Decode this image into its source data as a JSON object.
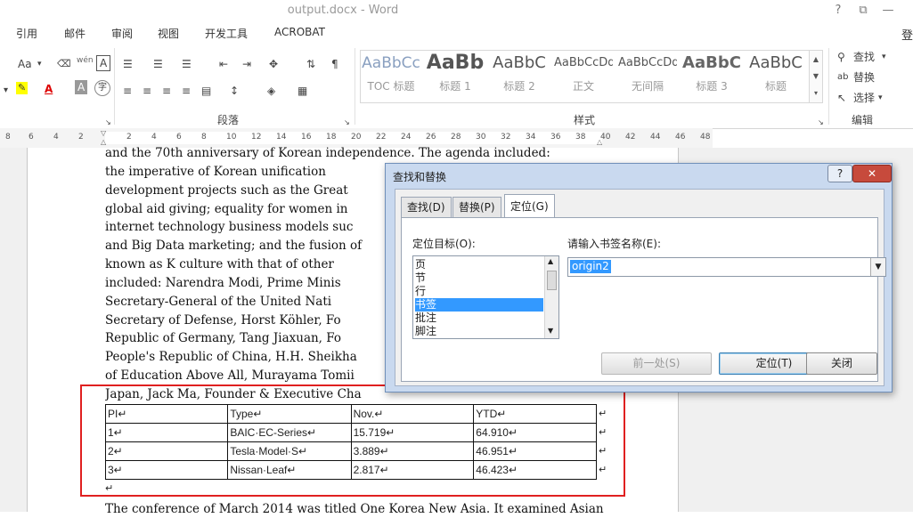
{
  "window": {
    "title": "output.docx - Word",
    "help": "?",
    "restore": "⧉",
    "minimize": "—",
    "user_initial": "登"
  },
  "tabs": [
    "引用",
    "邮件",
    "审阅",
    "视图",
    "开发工具",
    "ACROBAT"
  ],
  "ribbon": {
    "font_size_label": "Aa",
    "pinyin_label": "wén",
    "border_char_label": "A",
    "highlight_label": "A",
    "shading_label": "A",
    "enclose_label": "字",
    "paragraph_group": "段落",
    "styles_group": "样式",
    "edit_group": "编辑",
    "styles": [
      {
        "sample": "AaBbCc",
        "name": "TOC 标题"
      },
      {
        "sample": "AaBb",
        "name": "标题 1"
      },
      {
        "sample": "AaBbC",
        "name": "标题 2"
      },
      {
        "sample": "AaBbCcDd",
        "name": "正文"
      },
      {
        "sample": "AaBbCcDd",
        "name": "无间隔"
      },
      {
        "sample": "AaBbC",
        "name": "标题 3"
      },
      {
        "sample": "AaBbC",
        "name": "标题"
      }
    ],
    "find": "查找",
    "replace": "替换",
    "select": "选择"
  },
  "ruler": {
    "left_ticks": [
      "8",
      "6",
      "4",
      "2"
    ],
    "ticks": [
      "2",
      "4",
      "6",
      "8",
      "10",
      "12",
      "14",
      "16",
      "18",
      "20",
      "22",
      "24",
      "26",
      "28",
      "30",
      "32",
      "34",
      "36",
      "38",
      "40",
      "42",
      "44",
      "46",
      "48"
    ]
  },
  "document": {
    "lines": [
      "and the 70th anniversary of Korean independence. The agenda included:",
      "the imperative of Korean unification",
      "development projects such as the Great",
      "global aid giving; equality for women in",
      "internet technology business models suc",
      "and Big Data marketing; and the fusion of",
      "known as K culture with that of other",
      "included: Narendra Modi, Prime Minis",
      "Secretary-General of the United Nati",
      "Secretary of Defense, Horst Köhler, Fo",
      "Republic of Germany, Tang Jiaxuan, Fo",
      "People's Republic of China, H.H. Sheikha",
      "of Education Above All, Murayama Tomii",
      "Japan, Jack Ma, Founder & Executive Cha"
    ],
    "table": {
      "header": [
        "PI↵",
        "Type↵",
        "Nov.↵",
        "YTD↵"
      ],
      "rows": [
        [
          "1↵",
          "BAIC·EC-Series↵",
          "15.719↵",
          "64.910↵"
        ],
        [
          "2↵",
          "Tesla·Model·S↵",
          "3.889↵",
          "46.951↵"
        ],
        [
          "3↵",
          "Nissan·Leaf↵",
          "2.817↵",
          "46.423↵"
        ]
      ],
      "row_mark": "↵"
    },
    "after_table_mark": "↵",
    "last_line": "The conference of March 2014 was titled One Korea New Asia. It examined Asian"
  },
  "dialog": {
    "title": "查找和替换",
    "help": "?",
    "close": "✕",
    "tabs": [
      "查找(D)",
      "替换(P)",
      "定位(G)"
    ],
    "target_label": "定位目标(O):",
    "targets": [
      "页",
      "节",
      "行",
      "书签",
      "批注",
      "脚注"
    ],
    "selected_target": "书签",
    "bookmark_label": "请输入书签名称(E):",
    "bookmark_value": "origin2",
    "buttons": {
      "prev": "前一处(S)",
      "goto": "定位(T)",
      "close": "关闭"
    }
  }
}
